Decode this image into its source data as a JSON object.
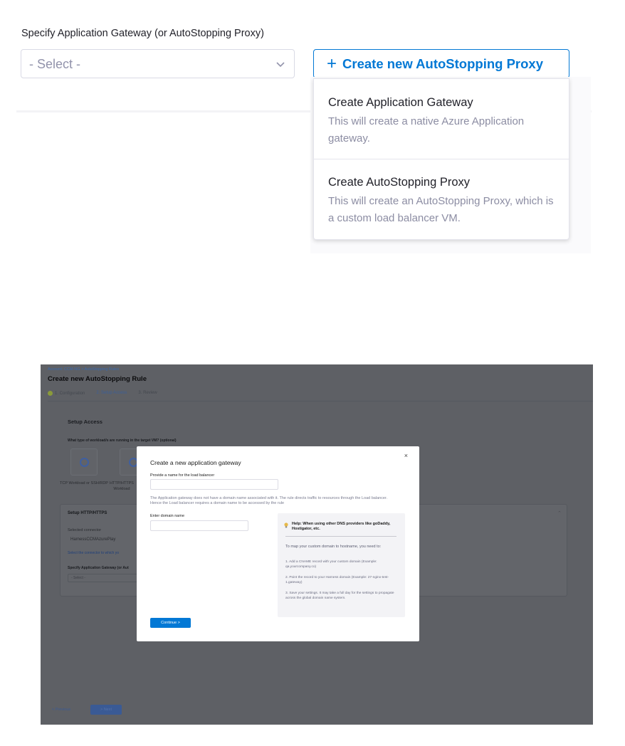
{
  "top": {
    "label": "Specify Application Gateway (or AutoStopping Proxy)",
    "select_placeholder": "- Select -",
    "create_button": "Create new AutoStopping Proxy",
    "dropdown": [
      {
        "title": "Create Application Gateway",
        "desc": "This will create a native Azure Application gateway."
      },
      {
        "title": "Create AutoStopping Proxy",
        "desc": "This will create an AutoStopping Proxy, which is a custom load balancer VM."
      }
    ]
  },
  "bg": {
    "breadcrumb": "Account: CCM-NG  >  AutoStopping Rules",
    "title": "Create new AutoStopping Rule",
    "steps": [
      "1. Configuration",
      "2. Setup Access",
      "3. Review"
    ],
    "setup_access": "Setup Access",
    "workload_question": "What type of workload/s are running in the target VM? (optional)",
    "workloads": [
      "TCP Workload or SSH/RDP",
      "HTTP/HTTPS Workload"
    ],
    "setup_http": "Setup HTTP/HTTPS",
    "selected_connector_label": "Selected connector",
    "selected_connector_value": "HarnessCCMAzurePlay",
    "connector_note": "Select the connector to which yo",
    "gateway_label": "Specify Application Gateway (or Aut",
    "gateway_select": "- Select -",
    "prev": "< Previous",
    "next": "> Next"
  },
  "modal": {
    "close": "×",
    "title": "Create a new application gateway",
    "name_label": "Provide a name for the load balancer",
    "description": "The Application gateway does not have a domain name associated with it. The rule directs traffic to resources through the Load balancer. Hence the Load balancer requires a domain name to be accessed by the rule",
    "domain_label": "Enter domain name",
    "help_title": "Help: When using other DNS providers like goDaddy, Hostigator, etc.",
    "help_intro": "To map your custom domain to hostname, you need to:",
    "help_steps": [
      "1. Add a CNAME record with your custom domain (Example: qa.yourcompany.co)",
      "2. Point the record to your Harness domain (Example: 27-nginx-test-1.gateway)",
      "3. Save your settings. It may take a full day for the settings to propagate across the global domain name system."
    ],
    "continue": "Continue  >"
  }
}
